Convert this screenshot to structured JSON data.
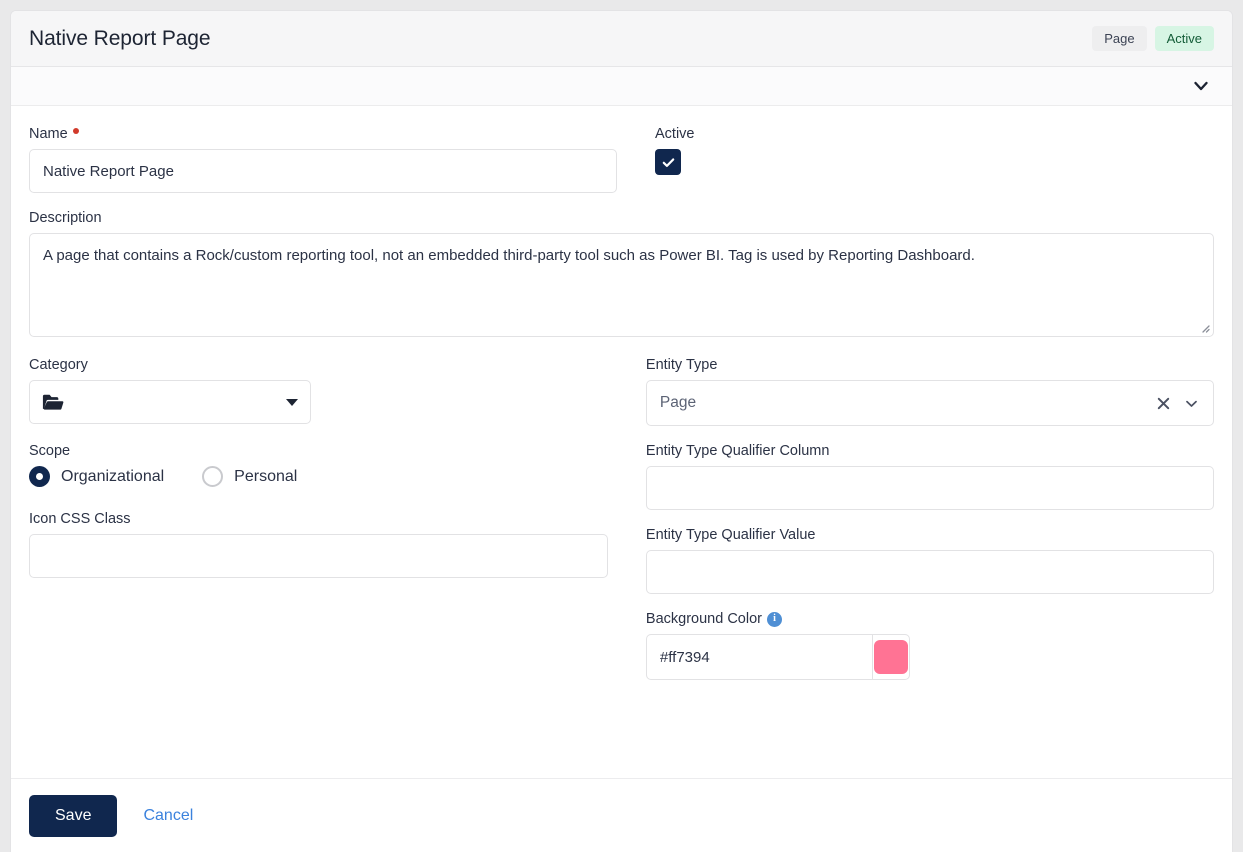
{
  "header": {
    "title": "Native Report Page",
    "badges": [
      {
        "label": "Page",
        "style": "default"
      },
      {
        "label": "Active",
        "style": "success"
      }
    ],
    "collapse_icon": "chevron-down-icon"
  },
  "form": {
    "name": {
      "label": "Name",
      "required": true,
      "value": "Native Report Page",
      "placeholder": ""
    },
    "active": {
      "label": "Active",
      "checked": true
    },
    "description": {
      "label": "Description",
      "value": "A page that contains a Rock/custom reporting tool, not an embedded third-party tool such as Power BI. Tag is used by Reporting Dashboard.",
      "placeholder": ""
    },
    "category": {
      "label": "Category",
      "value": "",
      "icon": "open-folder-icon"
    },
    "entity_type": {
      "label": "Entity Type",
      "value": "Page",
      "clear_icon": "close-icon",
      "expand_icon": "chevron-down-icon"
    },
    "scope": {
      "label": "Scope",
      "selected": "Organizational",
      "options": [
        {
          "label": "Organizational",
          "checked": true
        },
        {
          "label": "Personal",
          "checked": false
        }
      ]
    },
    "entity_type_qualifier_column": {
      "label": "Entity Type Qualifier Column",
      "value": "",
      "placeholder": ""
    },
    "entity_type_qualifier_value": {
      "label": "Entity Type Qualifier Value",
      "value": "",
      "placeholder": ""
    },
    "icon_css_class": {
      "label": "Icon CSS Class",
      "value": "",
      "placeholder": ""
    },
    "background_color": {
      "label": "Background Color",
      "value": "#ff7394",
      "swatch": "#ff7394",
      "info_icon": "info-icon",
      "info_glyph": "i"
    }
  },
  "footer": {
    "save_label": "Save",
    "cancel_label": "Cancel"
  },
  "colors": {
    "primary": "#10274e",
    "link": "#3b82dd",
    "required": "#d13a2b",
    "badge_success_bg": "#d7f5e4",
    "badge_default_bg": "#eeeeef",
    "swatch": "#ff7394",
    "info": "#4f8fd4"
  }
}
